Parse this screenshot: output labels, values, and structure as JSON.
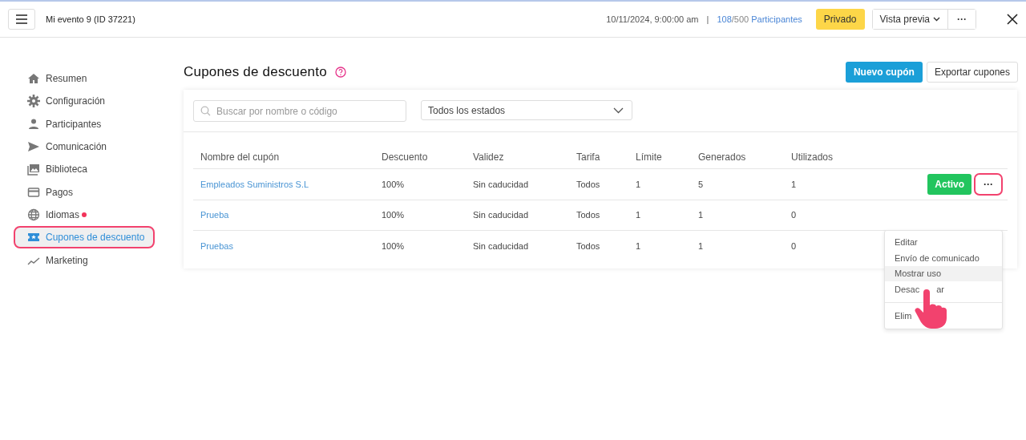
{
  "header": {
    "event_title": "Mi evento 9 (ID 37221)",
    "datetime": "10/11/2024, 9:00:00 am",
    "separator": "|",
    "registered": "108",
    "capacity": "/500",
    "participants_label": "Participantes",
    "privacy_badge": "Privado",
    "preview_button": "Vista previa",
    "more_button": "···"
  },
  "sidebar": {
    "items": [
      {
        "label": "Resumen",
        "selected": false,
        "highlighted": false,
        "alert": false
      },
      {
        "label": "Configuración",
        "selected": false,
        "highlighted": false,
        "alert": false
      },
      {
        "label": "Participantes",
        "selected": false,
        "highlighted": false,
        "alert": false
      },
      {
        "label": "Comunicación",
        "selected": false,
        "highlighted": false,
        "alert": false
      },
      {
        "label": "Biblioteca",
        "selected": false,
        "highlighted": false,
        "alert": false
      },
      {
        "label": "Pagos",
        "selected": false,
        "highlighted": false,
        "alert": false
      },
      {
        "label": "Idiomas",
        "selected": false,
        "highlighted": false,
        "alert": true
      },
      {
        "label": "Cupones de descuento",
        "selected": true,
        "highlighted": true,
        "alert": false
      },
      {
        "label": "Marketing",
        "selected": false,
        "highlighted": false,
        "alert": false
      }
    ]
  },
  "page": {
    "title": "Cupones de descuento",
    "new_button": "Nuevo cupón",
    "export_button": "Exportar cupones"
  },
  "filters": {
    "search": {
      "placeholder": "Buscar por nombre o código"
    },
    "status_select": "Todos los estados"
  },
  "table": {
    "columns": [
      "Nombre del cupón",
      "Descuento",
      "Validez",
      "Tarifa",
      "Límite",
      "Generados",
      "Utilizados"
    ],
    "rows": [
      {
        "cells": [
          "Empleados Suministros S.L",
          "100%",
          "Sin caducidad",
          "Todos",
          "1",
          "5",
          "1"
        ],
        "status": "Activo",
        "more": "···",
        "more_highlighted": true
      },
      {
        "cells": [
          "Prueba",
          "100%",
          "Sin caducidad",
          "Todos",
          "1",
          "1",
          "0"
        ]
      },
      {
        "cells": [
          "Pruebas",
          "100%",
          "Sin caducidad",
          "Todos",
          "1",
          "1",
          "0"
        ]
      }
    ]
  },
  "menu": {
    "items": [
      {
        "label": "Editar",
        "hovered": false,
        "divider_before": false
      },
      {
        "label": "Envío de comunicado",
        "hovered": false,
        "divider_before": false
      },
      {
        "label": "Mostrar uso",
        "hovered": true,
        "divider_before": false
      },
      {
        "label": "Desac",
        "label_after_cursor": "ar",
        "hovered": false,
        "divider_before": false
      },
      {
        "label": "Elim",
        "hovered": false,
        "divider_before": true
      }
    ]
  }
}
